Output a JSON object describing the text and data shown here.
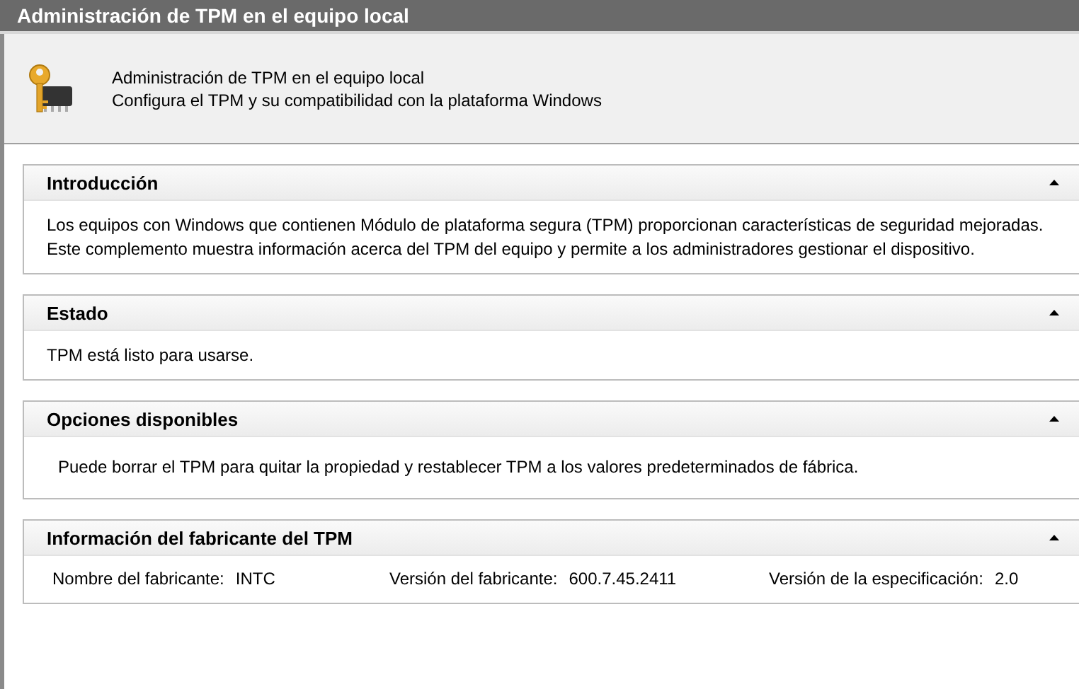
{
  "window": {
    "title": "Administración de TPM en el equipo local"
  },
  "header": {
    "title": "Administración de TPM en el equipo local",
    "subtitle": "Configura el TPM y su compatibilidad con la plataforma Windows"
  },
  "sections": [
    {
      "kind": "text",
      "title": "Introducción",
      "text": "Los equipos con Windows que contienen Módulo de plataforma segura (TPM) proporcionan características de seguridad mejoradas. Este complemento muestra información acerca del TPM del equipo y permite a los administradores gestionar el dispositivo."
    },
    {
      "kind": "text",
      "title": "Estado",
      "text": "TPM está listo para usarse."
    },
    {
      "kind": "text",
      "title": "Opciones disponibles",
      "text": "Puede borrar el TPM para quitar la propiedad y restablecer TPM a los valores predeterminados de fábrica."
    },
    {
      "kind": "fields",
      "title": "Información del fabricante del TPM",
      "fields": [
        {
          "label": "Nombre del fabricante:",
          "value": "INTC"
        },
        {
          "label": "Versión del fabricante:",
          "value": "600.7.45.2411"
        },
        {
          "label": "Versión de la especificación:",
          "value": "2.0"
        }
      ]
    }
  ]
}
